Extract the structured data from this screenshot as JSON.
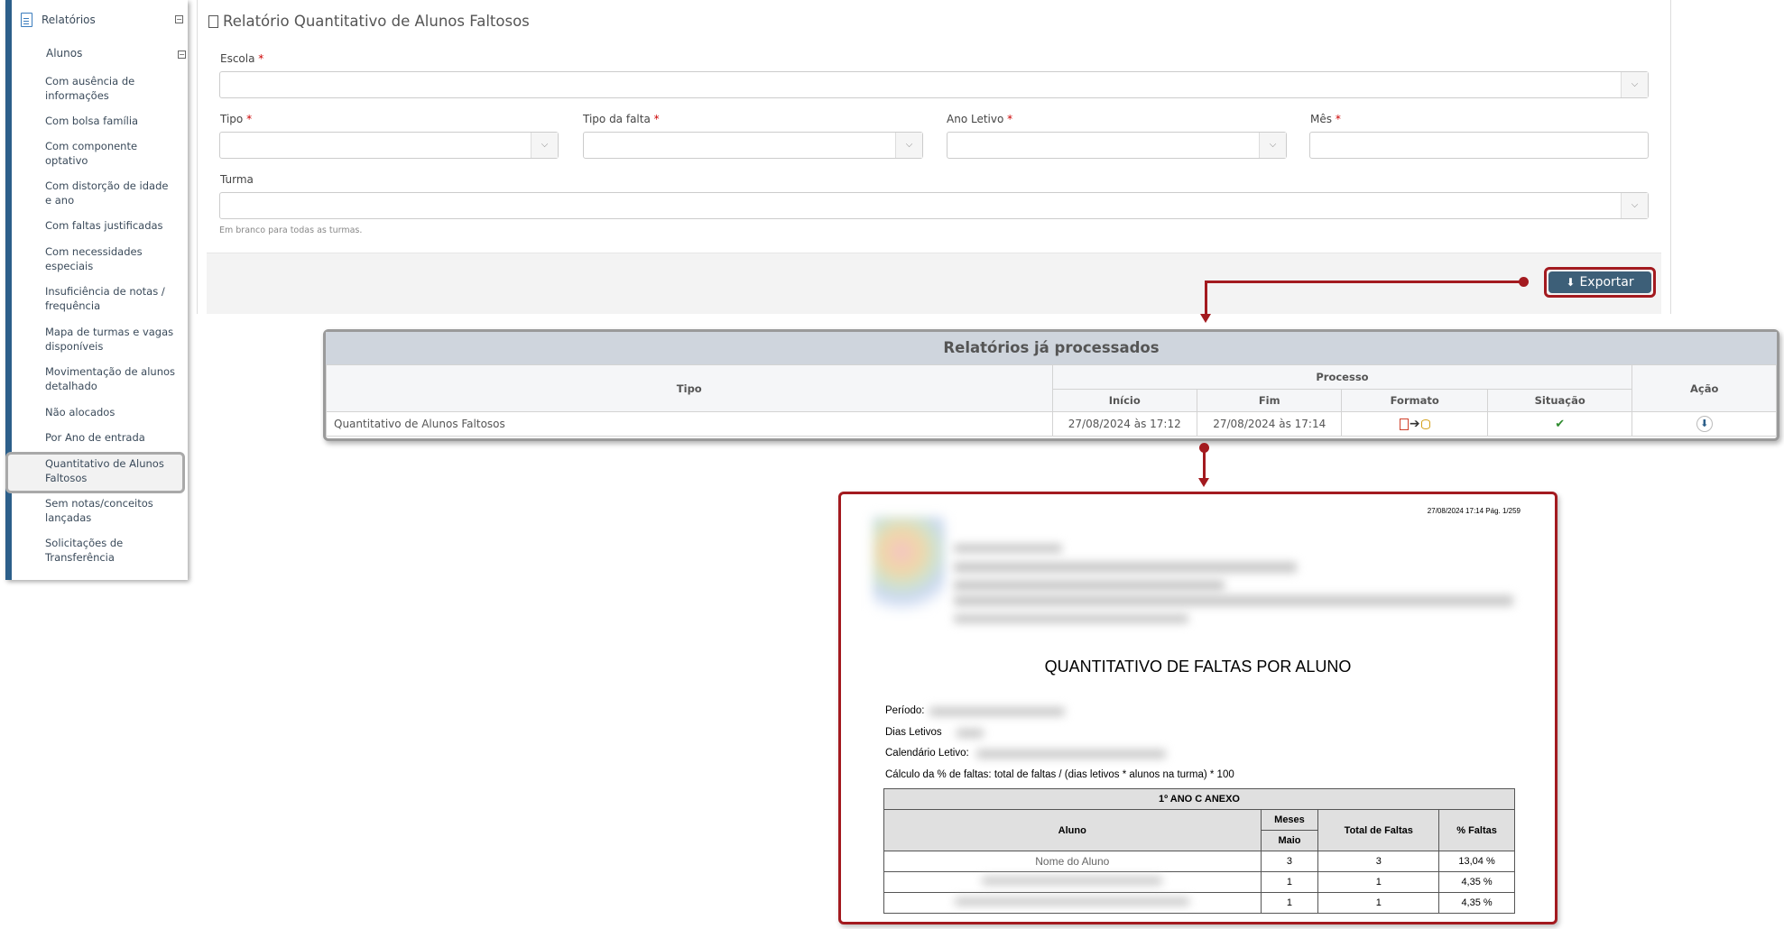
{
  "sidebar": {
    "header": "Relatórios",
    "group": "Alunos",
    "toggle": "−",
    "items": [
      "Com ausência de informações",
      "Com bolsa família",
      "Com componente optativo",
      "Com distorção de idade e ano",
      "Com faltas justificadas",
      "Com necessidades especiais",
      "Insuficiência de notas / frequência",
      "Mapa de turmas e vagas disponíveis",
      "Movimentação de alunos detalhado",
      "Não alocados",
      "Por Ano de entrada",
      "Quantitativo de Alunos Faltosos",
      "Sem notas/conceitos lançadas",
      "Solicitações de Transferência"
    ]
  },
  "form": {
    "title": "Relatório Quantitativo de Alunos Faltosos",
    "escola_label": "Escola",
    "tipo_label": "Tipo",
    "tipo_falta_label": "Tipo da falta",
    "ano_letivo_label": "Ano Letivo",
    "mes_label": "Mês",
    "turma_label": "Turma",
    "required_mark": "*",
    "turma_hint": "Em branco para todas as turmas.",
    "export_label": "Exportar"
  },
  "processed": {
    "title": "Relatórios já processados",
    "headers": {
      "tipo": "Tipo",
      "processo": "Processo",
      "acao": "Ação",
      "inicio": "Início",
      "fim": "Fim",
      "formato": "Formato",
      "situacao": "Situação"
    },
    "row": {
      "tipo": "Quantitativo de Alunos Faltosos",
      "inicio": "27/08/2024 às 17:12",
      "fim": "27/08/2024 às 17:14"
    }
  },
  "report": {
    "stamp": "27/08/2024 17:14   Pág. 1/259",
    "title": "QUANTITATIVO DE FALTAS POR ALUNO",
    "periodo": "Período:",
    "dias_letivos": "Dias Letivos",
    "calendario": "Calendário Letivo:",
    "calculo": "Cálculo da % de faltas: total de faltas / (dias letivos * alunos na turma) * 100",
    "turma": "1º ANO C ANEXO",
    "col_aluno": "Aluno",
    "col_meses": "Meses",
    "col_maio": "Maio",
    "col_total": "Total de Faltas",
    "col_pct": "% Faltas",
    "rows": [
      {
        "aluno": "Nome do Aluno",
        "maio": "3",
        "total": "3",
        "pct": "13,04 %"
      },
      {
        "aluno": "",
        "maio": "1",
        "total": "1",
        "pct": "4,35 %"
      },
      {
        "aluno": "",
        "maio": "1",
        "total": "1",
        "pct": "4,35 %"
      }
    ]
  }
}
